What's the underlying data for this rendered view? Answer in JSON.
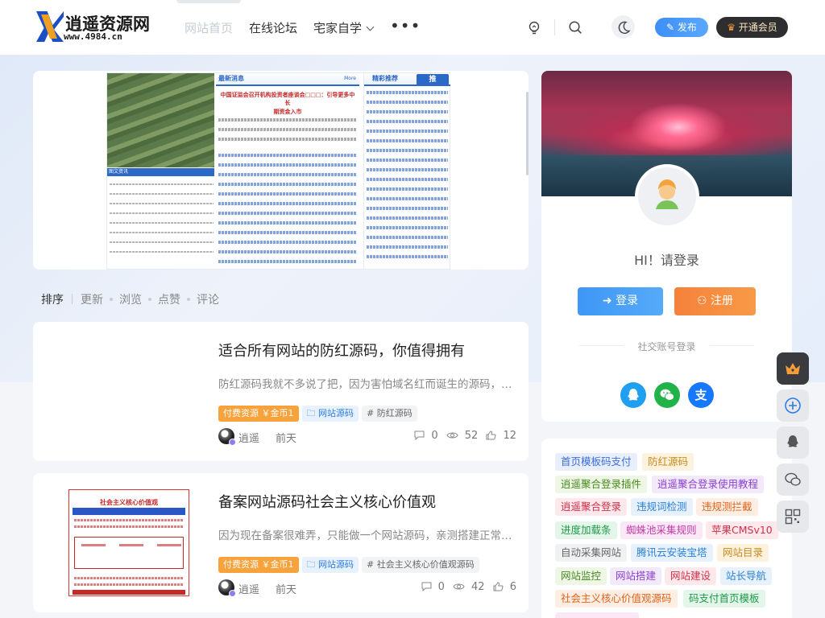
{
  "header": {
    "logo_title": "逍遥资源网",
    "logo_url": "www.4984.cn",
    "nav": [
      {
        "label": "网站首页",
        "active": true
      },
      {
        "label": "在线论坛"
      },
      {
        "label": "宅家自学"
      }
    ],
    "more_label": "•••",
    "publish_label": "发布",
    "vip_label": "开通会员"
  },
  "banner": {
    "headline_tab": "最新消息",
    "more": "More",
    "title_l1": "中国证监会召开机构投资者座谈会□□□：引导更多中长",
    "title_l2": "期资金入市",
    "recommend_tab": "精彩推荐",
    "recommend_badge": "推",
    "left_caption": "图文资讯"
  },
  "sortbar": {
    "title": "排序",
    "items": [
      "更新",
      "浏览",
      "点赞",
      "评论"
    ]
  },
  "posts": [
    {
      "title": "适合所有网站的防红源码，你值得拥有",
      "excerpt": "防红源码我就不多说了把，因为害怕域名红而诞生的源码，从此…",
      "paid_label": "付费资源 ￥金币1",
      "category": "网站源码",
      "keyword": "# 防红源码",
      "author": "逍遥",
      "time": "前天",
      "comments": "0",
      "views": "52",
      "likes": "12"
    },
    {
      "title": "备案网站源码社会主义核心价值观",
      "excerpt": "因为现在备案很难弄，只能做一个网站源码，亲测搭建正常，能…",
      "paid_label": "付费资源 ￥金币1",
      "category": "网站源码",
      "keyword": "# 社会主义核心价值观源码",
      "author": "逍遥",
      "time": "前天",
      "comments": "0",
      "views": "42",
      "likes": "6",
      "thumb_title": "社会主义核心价值观"
    }
  ],
  "user_card": {
    "greeting": "HI！请登录",
    "login_label": "登录",
    "register_label": "注册",
    "social_title": "社交账号登录"
  },
  "tag_cloud": [
    {
      "label": "首页模板码支付",
      "color": "#3d6fd9",
      "bg": "#e8eefc"
    },
    {
      "label": "防红源码",
      "color": "#c98a1a",
      "bg": "#fdf2de"
    },
    {
      "label": "逍遥聚合登录插件",
      "color": "#4a8a1f",
      "bg": "#eef6e6"
    },
    {
      "label": "逍遥聚合登录使用教程",
      "color": "#8a3fd1",
      "bg": "#f2e9fb"
    },
    {
      "label": "逍遥聚合登录",
      "color": "#d12f4a",
      "bg": "#fde8ec"
    },
    {
      "label": "违规词检测",
      "color": "#2a7fd6",
      "bg": "#e6f1fc"
    },
    {
      "label": "违规测拦截",
      "color": "#e0631a",
      "bg": "#fdeee4"
    },
    {
      "label": "进度加载条",
      "color": "#1f9a4a",
      "bg": "#e4f6ea"
    },
    {
      "label": "蜘蛛池采集规则",
      "color": "#c23aa8",
      "bg": "#fbe8f6"
    },
    {
      "label": "苹果CMSv10",
      "color": "#d12f4a",
      "bg": "#fde8ec"
    },
    {
      "label": "自动采集网站",
      "color": "#666666",
      "bg": "#f0f1f3"
    },
    {
      "label": "腾讯云安装宝塔",
      "color": "#2a7fd6",
      "bg": "#e6f1fc"
    },
    {
      "label": "网站目录",
      "color": "#c98a1a",
      "bg": "#fdf2de"
    },
    {
      "label": "网站监控",
      "color": "#4a8a1f",
      "bg": "#eef6e6"
    },
    {
      "label": "网站搭建",
      "color": "#8a3fd1",
      "bg": "#f2e9fb"
    },
    {
      "label": "网站建设",
      "color": "#d12f4a",
      "bg": "#fde8ec"
    },
    {
      "label": "站长导航",
      "color": "#2a7fd6",
      "bg": "#e6f1fc"
    },
    {
      "label": "社会主义核心价值观源码",
      "color": "#e0631a",
      "bg": "#fdeee4"
    },
    {
      "label": "码支付首页模板",
      "color": "#1f9a4a",
      "bg": "#e4f6ea"
    },
    {
      "label": "",
      "color": "#c23aa8",
      "bg": "#fbe8f6"
    }
  ]
}
